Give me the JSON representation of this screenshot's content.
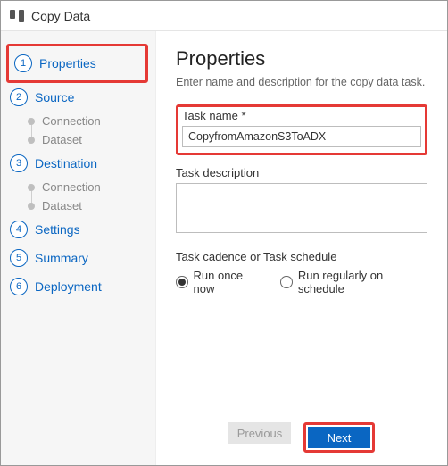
{
  "titlebar": {
    "title": "Copy Data"
  },
  "sidebar": {
    "steps": [
      {
        "num": "1",
        "label": "Properties",
        "active": true,
        "subs": []
      },
      {
        "num": "2",
        "label": "Source",
        "subs": [
          "Connection",
          "Dataset"
        ]
      },
      {
        "num": "3",
        "label": "Destination",
        "subs": [
          "Connection",
          "Dataset"
        ]
      },
      {
        "num": "4",
        "label": "Settings",
        "subs": []
      },
      {
        "num": "5",
        "label": "Summary",
        "subs": []
      },
      {
        "num": "6",
        "label": "Deployment",
        "subs": []
      }
    ]
  },
  "content": {
    "heading": "Properties",
    "subtitle": "Enter name and description for the copy data task.",
    "task_name_label": "Task name *",
    "task_name_value": "CopyfromAmazonS3ToADX",
    "task_desc_label": "Task description",
    "task_desc_value": "",
    "cadence_label": "Task cadence or Task schedule",
    "cadence_options": {
      "once": "Run once now",
      "schedule": "Run regularly on schedule"
    },
    "cadence_selected": "once"
  },
  "footer": {
    "prev": "Previous",
    "next": "Next"
  }
}
